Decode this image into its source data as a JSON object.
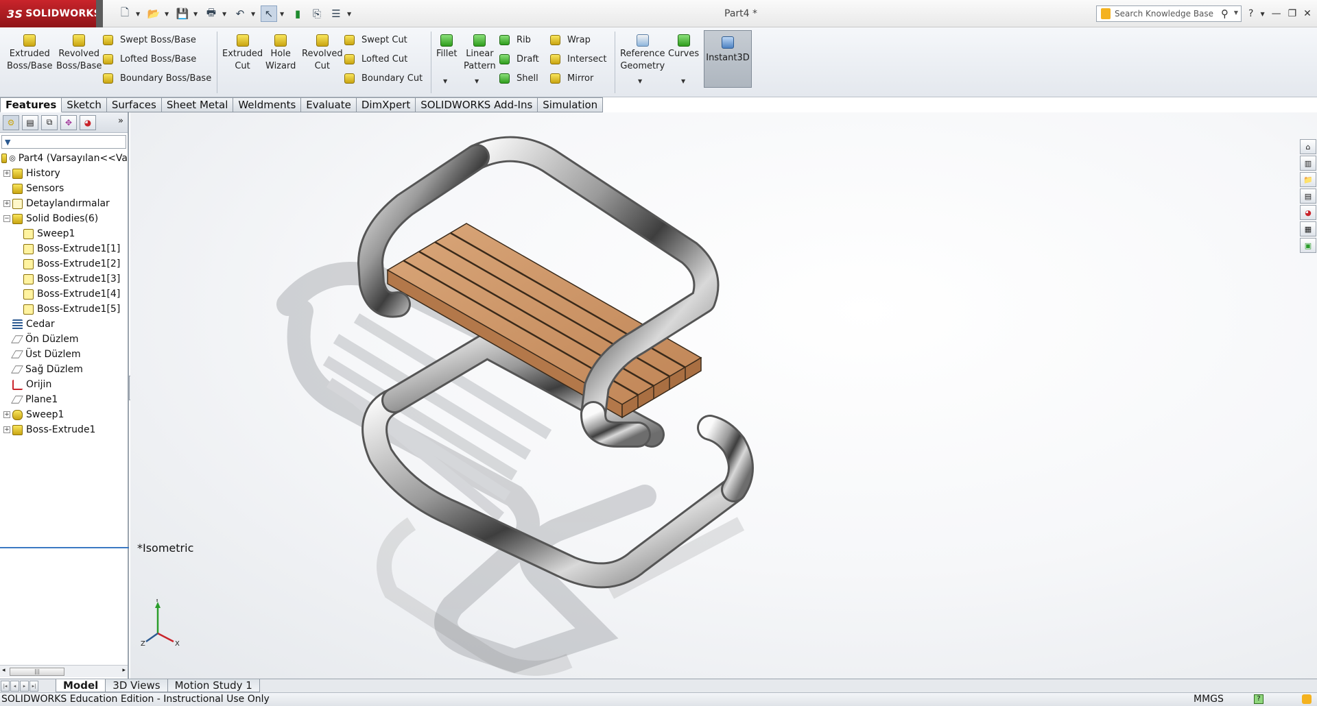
{
  "app": {
    "brand": "SOLIDWORKS",
    "brand_mark": "3S",
    "document_title": "Part4 *",
    "search_placeholder": "Search Knowledge Base"
  },
  "command_manager": {
    "big_buttons": [
      {
        "id": "extruded-boss",
        "line1": "Extruded",
        "line2": "Boss/Base"
      },
      {
        "id": "revolved-boss",
        "line1": "Revolved",
        "line2": "Boss/Base"
      },
      {
        "id": "extruded-cut",
        "line1": "Extruded",
        "line2": "Cut"
      },
      {
        "id": "hole-wizard",
        "line1": "Hole",
        "line2": "Wizard"
      },
      {
        "id": "revolved-cut",
        "line1": "Revolved",
        "line2": "Cut"
      },
      {
        "id": "fillet",
        "line1": "Fillet",
        "line2": ""
      },
      {
        "id": "linear-pattern",
        "line1": "Linear",
        "line2": "Pattern"
      },
      {
        "id": "reference-geometry",
        "line1": "Reference",
        "line2": "Geometry"
      },
      {
        "id": "curves",
        "line1": "Curves",
        "line2": ""
      }
    ],
    "small_buttons": {
      "swept_boss": "Swept Boss/Base",
      "lofted_boss": "Lofted Boss/Base",
      "boundary_boss": "Boundary Boss/Base",
      "swept_cut": "Swept Cut",
      "lofted_cut": "Lofted Cut",
      "boundary_cut": "Boundary Cut",
      "rib": "Rib",
      "draft": "Draft",
      "shell": "Shell",
      "wrap": "Wrap",
      "intersect": "Intersect",
      "mirror": "Mirror"
    },
    "instant3d": "Instant3D"
  },
  "tabs": [
    "Features",
    "Sketch",
    "Surfaces",
    "Sheet Metal",
    "Weldments",
    "Evaluate",
    "DimXpert",
    "SOLIDWORKS Add-Ins",
    "Simulation"
  ],
  "feature_tree": {
    "root": "Part4  (Varsayılan<<Va",
    "items": [
      {
        "label": "History",
        "expandable": true,
        "level": 0,
        "icon": "history-icon"
      },
      {
        "label": "Sensors",
        "expandable": false,
        "level": 0,
        "icon": "sensors-icon"
      },
      {
        "label": "Detaylandırmalar",
        "expandable": true,
        "level": 0,
        "icon": "annotations-icon"
      },
      {
        "label": "Solid Bodies(6)",
        "expandable": true,
        "expanded": true,
        "level": 0,
        "icon": "solid-bodies-icon"
      },
      {
        "label": "Sweep1",
        "expandable": false,
        "level": 1,
        "icon": "body-icon"
      },
      {
        "label": "Boss-Extrude1[1]",
        "expandable": false,
        "level": 1,
        "icon": "body-icon"
      },
      {
        "label": "Boss-Extrude1[2]",
        "expandable": false,
        "level": 1,
        "icon": "body-icon"
      },
      {
        "label": "Boss-Extrude1[3]",
        "expandable": false,
        "level": 1,
        "icon": "body-icon"
      },
      {
        "label": "Boss-Extrude1[4]",
        "expandable": false,
        "level": 1,
        "icon": "body-icon"
      },
      {
        "label": "Boss-Extrude1[5]",
        "expandable": false,
        "level": 1,
        "icon": "body-icon"
      },
      {
        "label": "Cedar",
        "expandable": false,
        "level": 0,
        "icon": "material-icon"
      },
      {
        "label": "Ön Düzlem",
        "expandable": false,
        "level": 0,
        "icon": "plane-icon"
      },
      {
        "label": "Üst Düzlem",
        "expandable": false,
        "level": 0,
        "icon": "plane-icon"
      },
      {
        "label": "Sağ Düzlem",
        "expandable": false,
        "level": 0,
        "icon": "plane-icon"
      },
      {
        "label": "Orijin",
        "expandable": false,
        "level": 0,
        "icon": "origin-icon"
      },
      {
        "label": "Plane1",
        "expandable": false,
        "level": 0,
        "icon": "plane-icon"
      },
      {
        "label": "Sweep1",
        "expandable": true,
        "level": 0,
        "icon": "sweep-icon"
      },
      {
        "label": "Boss-Extrude1",
        "expandable": true,
        "level": 0,
        "icon": "extrude-icon"
      }
    ]
  },
  "viewport": {
    "view_label": "*Isometric",
    "triad": {
      "x": "X",
      "y": "Y",
      "z": "Z"
    }
  },
  "bottom_tabs": [
    "Model",
    "3D Views",
    "Motion Study 1"
  ],
  "status": {
    "edition": "SOLIDWORKS Education Edition - Instructional Use Only",
    "units": "MMGS"
  },
  "colors": {
    "brand_red": "#c9242b",
    "wood": "#c98e60",
    "chrome": "#8f8f8f",
    "accent": "#3a78c2"
  }
}
